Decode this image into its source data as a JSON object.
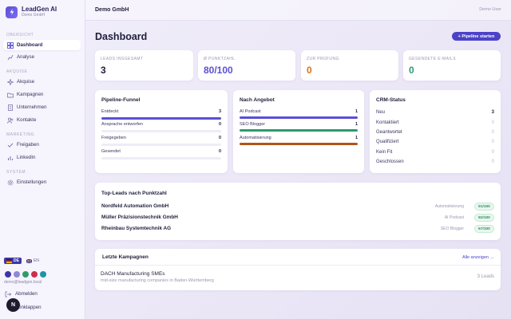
{
  "app": {
    "name": "LeadGen AI",
    "tenant": "Demo GmbH"
  },
  "colors": {
    "accent": "#4b42c8",
    "funnel_bar": "#5b4fd6",
    "green_bar": "#2f9a6e",
    "orange_bar": "#b0541a"
  },
  "sidebar": {
    "sections": [
      {
        "title": "Übersicht",
        "items": [
          {
            "label": "Dashboard",
            "icon": "grid-icon",
            "active": true
          },
          {
            "label": "Analyse",
            "icon": "chart-icon"
          }
        ]
      },
      {
        "title": "Akquise",
        "items": [
          {
            "label": "Akquise",
            "icon": "sparkle-icon"
          },
          {
            "label": "Kampagnen",
            "icon": "folder-icon"
          },
          {
            "label": "Unternehmen",
            "icon": "building-icon"
          },
          {
            "label": "Kontakte",
            "icon": "users-icon"
          }
        ]
      },
      {
        "title": "Marketing",
        "items": [
          {
            "label": "Freigaben",
            "icon": "check-icon"
          },
          {
            "label": "LinkedIn",
            "icon": "bar-icon"
          }
        ]
      },
      {
        "title": "System",
        "items": [
          {
            "label": "Einstellungen",
            "icon": "gear-icon"
          }
        ]
      }
    ],
    "lang_active": "DE",
    "lang_other": "EN",
    "swatches": [
      "#3d36a8",
      "#8f88d8",
      "#2f9a6e",
      "#c8314e",
      "#1f93a8"
    ],
    "email": "demo@leadgen.local",
    "logout": "Abmelden",
    "collapse": "Einklappen",
    "fab": "N"
  },
  "topbar": {
    "company": "Demo GmbH",
    "user": "Demo User"
  },
  "main": {
    "title": "Dashboard",
    "primary_button": "+ Pipeline starten",
    "stats": [
      {
        "label": "Leads insgesamt",
        "value": "3",
        "color": "#1f1f3a"
      },
      {
        "label": "Ø Punktzahl",
        "value": "80/100",
        "color": "#5b4fd6"
      },
      {
        "label": "Zur Prüfung",
        "value": "0",
        "color": "#d9711b"
      },
      {
        "label": "Gesendete E-Mails",
        "value": "0",
        "color": "#2f9a6e"
      }
    ],
    "funnel": {
      "title": "Pipeline-Funnel",
      "rows": [
        {
          "label": "Entdeckt",
          "value": "3",
          "fill": 1.0
        },
        {
          "label": "Ansprache entworfen",
          "value": "0",
          "fill": 0
        },
        {
          "label": "Freigegeben",
          "value": "0",
          "fill": 0
        },
        {
          "label": "Gesendet",
          "value": "0",
          "fill": 0
        }
      ]
    },
    "offer": {
      "title": "Nach Angebot",
      "rows": [
        {
          "label": "AI Podcast",
          "value": "1",
          "fill": 1.0,
          "color": "#5b4fd6"
        },
        {
          "label": "SEO Blogger",
          "value": "1",
          "fill": 1.0,
          "color": "#2f9a6e"
        },
        {
          "label": "Automatisierung",
          "value": "1",
          "fill": 1.0,
          "color": "#b0541a"
        }
      ]
    },
    "crm": {
      "title": "CRM-Status",
      "rows": [
        {
          "label": "Neu",
          "value": "3",
          "strong": true
        },
        {
          "label": "Kontaktiert",
          "value": "0"
        },
        {
          "label": "Geantwortet",
          "value": "0"
        },
        {
          "label": "Qualifiziert",
          "value": "0"
        },
        {
          "label": "Kein Fit",
          "value": "0"
        },
        {
          "label": "Geschlossen",
          "value": "0"
        }
      ]
    },
    "top_leads": {
      "title": "Top-Leads nach Punktzahl",
      "rows": [
        {
          "name": "Nordfeld Automation GmbH",
          "tag": "Automatisierung",
          "score": "91/100"
        },
        {
          "name": "Müller Präzisionstechnik GmbH",
          "tag": "AI Podcast",
          "score": "82/100"
        },
        {
          "name": "Rheinbau Systemtechnik AG",
          "tag": "SEO Blogger",
          "score": "67/100"
        }
      ]
    },
    "campaigns": {
      "title": "Letzte Kampagnen",
      "link": "Alle anzeigen →",
      "item": {
        "name": "DACH Manufacturing SMEs",
        "desc": "mid-size manufacturing companies in Baden-Württemberg",
        "leads": "3 Leads"
      }
    }
  }
}
